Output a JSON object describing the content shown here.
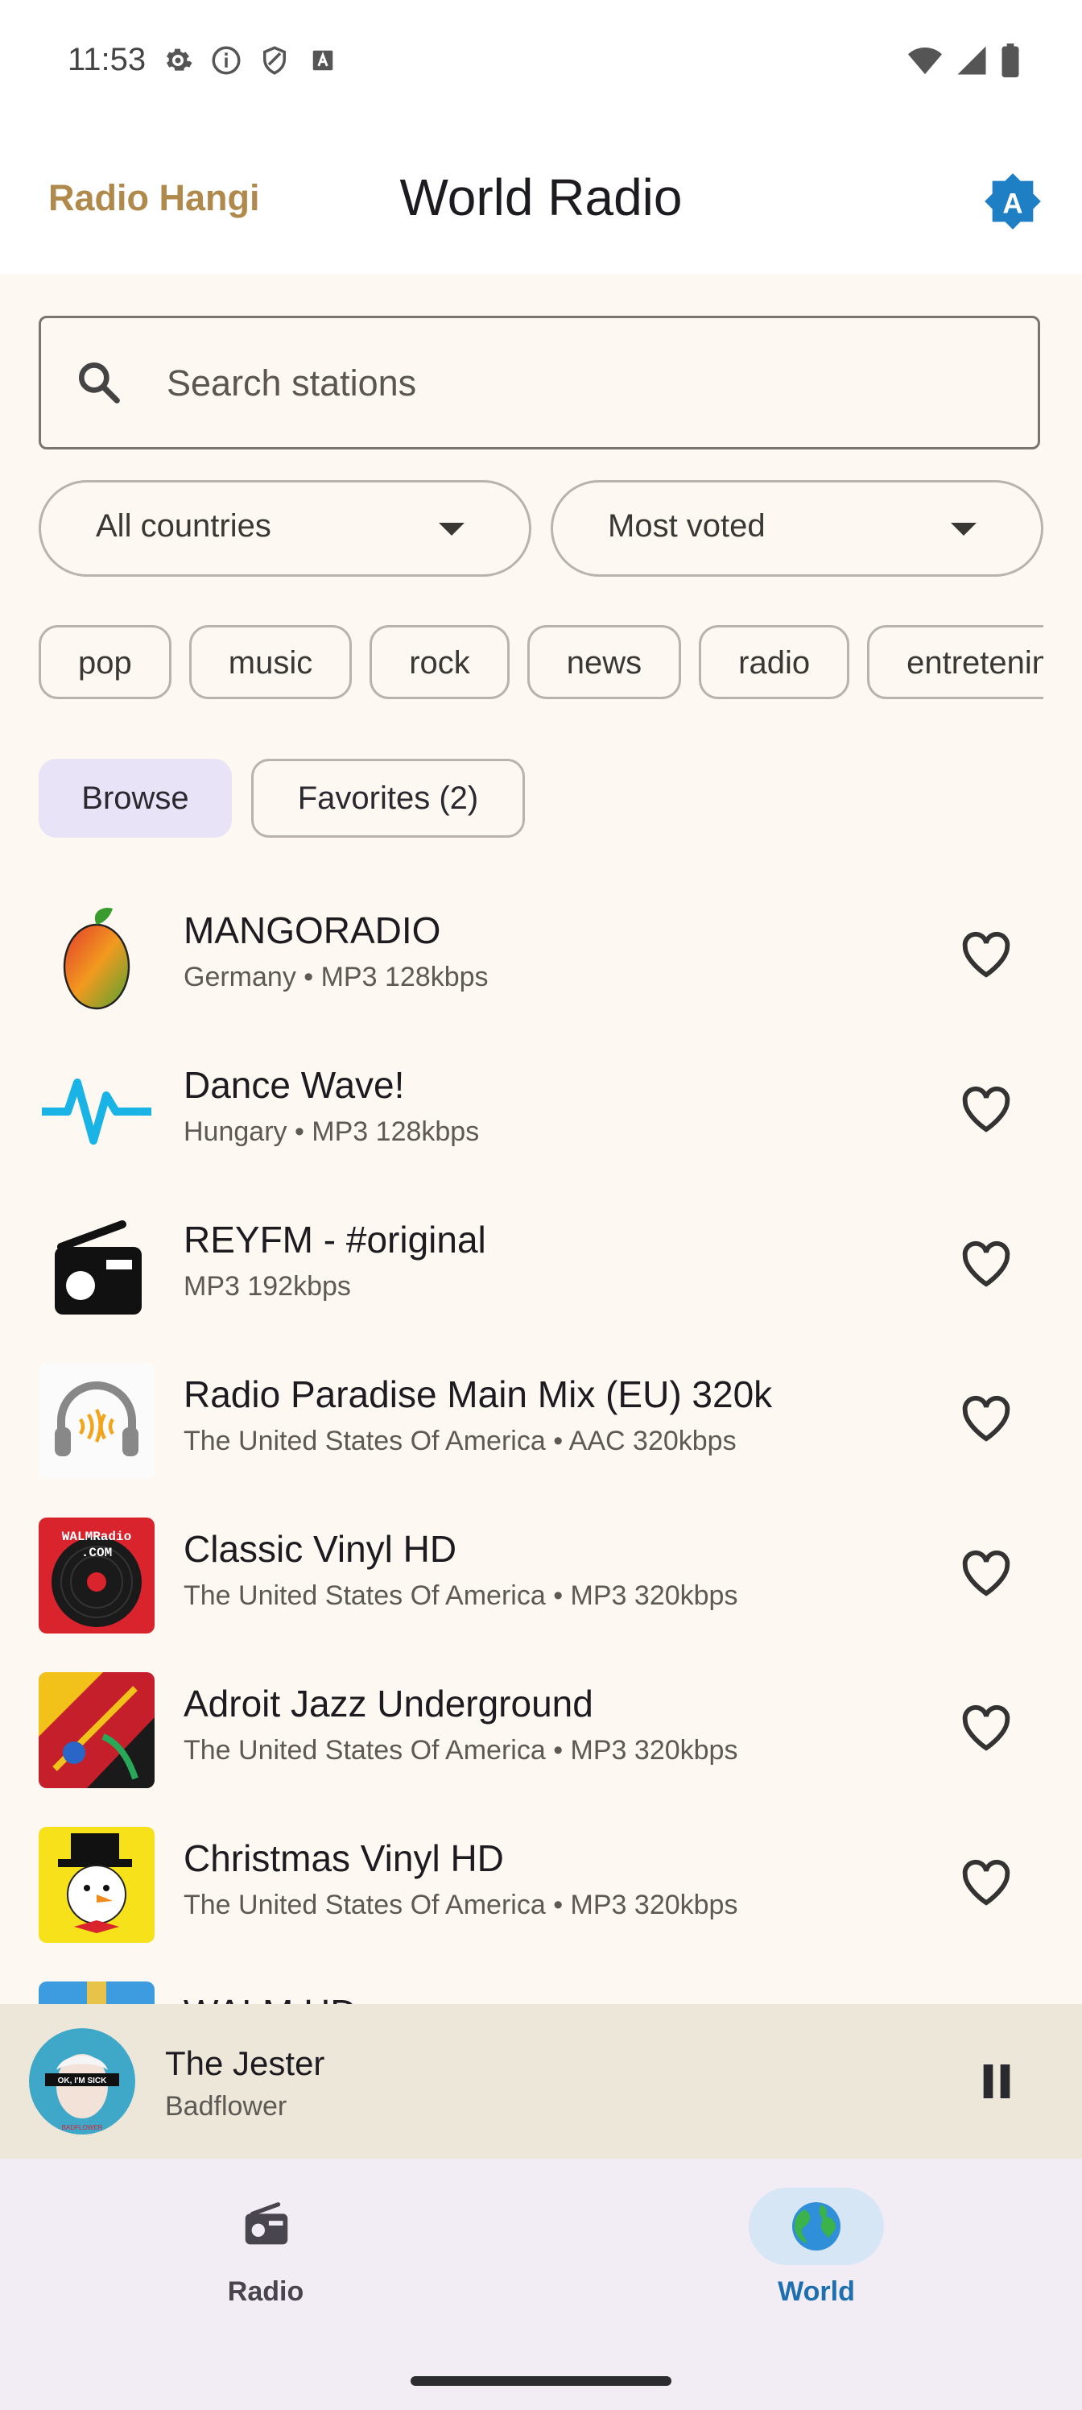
{
  "status_bar": {
    "time": "11:53"
  },
  "app_bar": {
    "brand": "Radio Hangi",
    "title": "World Radio"
  },
  "search": {
    "placeholder": "Search stations",
    "value": ""
  },
  "filters": {
    "country": "All countries",
    "sort": "Most voted"
  },
  "genres": [
    "pop",
    "music",
    "rock",
    "news",
    "radio",
    "entretenimiento"
  ],
  "segments": {
    "browse": "Browse",
    "favorites": "Favorites (2)",
    "active": "browse"
  },
  "stations": [
    {
      "name": "MANGORADIO",
      "meta": "Germany • MP3 128kbps",
      "logo": "mango-logo"
    },
    {
      "name": "Dance Wave!",
      "meta": "Hungary • MP3 128kbps",
      "logo": "wave-logo"
    },
    {
      "name": "REYFM - #original",
      "meta": "MP3 192kbps",
      "logo": "radio-icon"
    },
    {
      "name": "Radio Paradise Main Mix (EU) 320k",
      "meta": "The United States Of America • AAC 320kbps",
      "logo": "headphones-logo"
    },
    {
      "name": "Classic Vinyl HD",
      "meta": "The United States Of America • MP3 320kbps",
      "logo": "vinyl-logo",
      "logo_text": "WALMRadio\n.COM"
    },
    {
      "name": "Adroit Jazz Underground",
      "meta": "The United States Of America • MP3 320kbps",
      "logo": "jazz-logo"
    },
    {
      "name": "Christmas Vinyl HD",
      "meta": "The United States Of America • MP3 320kbps",
      "logo": "snowman-logo"
    },
    {
      "name": "WALM HD",
      "meta": "",
      "logo": "partial-logo"
    }
  ],
  "player": {
    "title": "The Jester",
    "artist": "Badflower",
    "art_text": "OK, I'M SICK",
    "art_caption": "BADFLOWER",
    "state": "playing"
  },
  "nav": {
    "items": [
      {
        "label": "Radio",
        "icon": "radio-icon"
      },
      {
        "label": "World",
        "icon": "globe-icon",
        "active": true
      }
    ]
  },
  "colors": {
    "brand": "#b08a4c",
    "accent": "#1e6fb0",
    "pill": "#d6e6f5",
    "background": "#fdf8f1"
  }
}
